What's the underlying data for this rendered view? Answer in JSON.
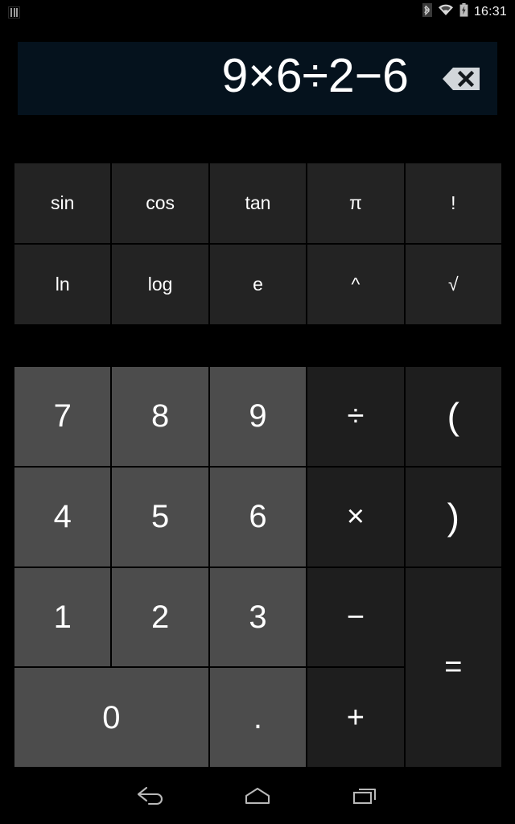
{
  "status_bar": {
    "notification_icon": "notification-bars-icon",
    "bluetooth_icon": "bluetooth-icon",
    "wifi_icon": "wifi-icon",
    "battery_icon": "battery-charging-icon",
    "time": "16:31"
  },
  "display": {
    "expression": "9×6÷2−6",
    "backspace_icon": "backspace-icon",
    "background_color": "#05121d"
  },
  "function_pad": {
    "keys": [
      {
        "label": "sin",
        "name": "sin-key"
      },
      {
        "label": "cos",
        "name": "cos-key"
      },
      {
        "label": "tan",
        "name": "tan-key"
      },
      {
        "label": "π",
        "name": "pi-key"
      },
      {
        "label": "!",
        "name": "factorial-key"
      },
      {
        "label": "ln",
        "name": "ln-key"
      },
      {
        "label": "log",
        "name": "log-key"
      },
      {
        "label": "e",
        "name": "e-key"
      },
      {
        "label": "^",
        "name": "power-key"
      },
      {
        "label": "√",
        "name": "sqrt-key"
      }
    ],
    "key_color": "#232323"
  },
  "keypad": {
    "keys": [
      {
        "label": "7",
        "name": "digit-7-key",
        "kind": "digit"
      },
      {
        "label": "8",
        "name": "digit-8-key",
        "kind": "digit"
      },
      {
        "label": "9",
        "name": "digit-9-key",
        "kind": "digit"
      },
      {
        "label": "÷",
        "name": "divide-key",
        "kind": "op"
      },
      {
        "label": "(",
        "name": "open-paren-key",
        "kind": "op"
      },
      {
        "label": "4",
        "name": "digit-4-key",
        "kind": "digit"
      },
      {
        "label": "5",
        "name": "digit-5-key",
        "kind": "digit"
      },
      {
        "label": "6",
        "name": "digit-6-key",
        "kind": "digit"
      },
      {
        "label": "×",
        "name": "multiply-key",
        "kind": "op"
      },
      {
        "label": ")",
        "name": "close-paren-key",
        "kind": "op"
      },
      {
        "label": "1",
        "name": "digit-1-key",
        "kind": "digit"
      },
      {
        "label": "2",
        "name": "digit-2-key",
        "kind": "digit"
      },
      {
        "label": "3",
        "name": "digit-3-key",
        "kind": "digit"
      },
      {
        "label": "−",
        "name": "minus-key",
        "kind": "op"
      },
      {
        "label": "=",
        "name": "equals-key",
        "kind": "op"
      },
      {
        "label": "0",
        "name": "digit-0-key",
        "kind": "digit"
      },
      {
        "label": ".",
        "name": "decimal-point-key",
        "kind": "digit"
      },
      {
        "label": "+",
        "name": "plus-key",
        "kind": "op"
      }
    ],
    "digit_color": "#4c4c4c",
    "operator_color": "#1e1e1e"
  },
  "nav_bar": {
    "back_icon": "back-icon",
    "home_icon": "home-icon",
    "recents_icon": "recents-icon"
  }
}
